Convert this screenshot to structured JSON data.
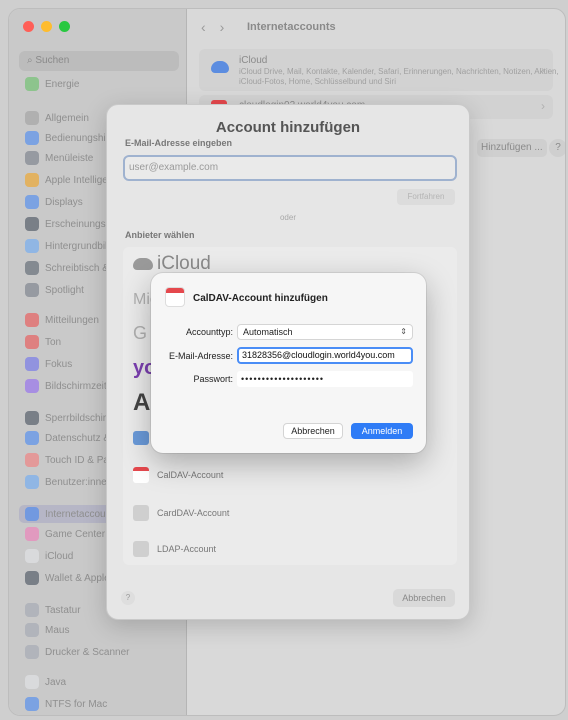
{
  "window": {
    "title": "Internetaccounts",
    "traffic": [
      "#ff5f57",
      "#febc2e",
      "#28c840"
    ]
  },
  "sidebar": {
    "search_placeholder": "Suchen",
    "items": [
      {
        "label": "Energie",
        "color": "#5bbf5b"
      },
      {
        "label": "Allgemein",
        "color": "#9a9a9a"
      },
      {
        "label": "Bedienungshilfen",
        "color": "#3b82f6"
      },
      {
        "label": "Menüleiste",
        "color": "#6b7280"
      },
      {
        "label": "Apple Intelligence",
        "color": "#f59e0b"
      },
      {
        "label": "Displays",
        "color": "#3b82f6"
      },
      {
        "label": "Erscheinungsbild",
        "color": "#374151"
      },
      {
        "label": "Hintergrundbild",
        "color": "#60a5fa"
      },
      {
        "label": "Schreibtisch & Dock",
        "color": "#4b5563"
      },
      {
        "label": "Spotlight",
        "color": "#6b7280"
      },
      {
        "label": "Mitteilungen",
        "color": "#ef4444"
      },
      {
        "label": "Ton",
        "color": "#ef4444"
      },
      {
        "label": "Fokus",
        "color": "#6366f1"
      },
      {
        "label": "Bildschirmzeit",
        "color": "#8b5cf6"
      },
      {
        "label": "Sperrbildschirm",
        "color": "#374151"
      },
      {
        "label": "Datenschutz & Sicherheit",
        "color": "#3b82f6"
      },
      {
        "label": "Touch ID & Passwort",
        "color": "#f87171"
      },
      {
        "label": "Benutzer:innen & Gruppen",
        "color": "#60a5fa"
      },
      {
        "label": "Internetaccounts",
        "color": "#3b82f6"
      },
      {
        "label": "Game Center",
        "color": "#f472b6"
      },
      {
        "label": "iCloud",
        "color": "#e5e7eb"
      },
      {
        "label": "Wallet & Apple Pay",
        "color": "#374151"
      },
      {
        "label": "Tastatur",
        "color": "#9ca3af"
      },
      {
        "label": "Maus",
        "color": "#9ca3af"
      },
      {
        "label": "Drucker & Scanner",
        "color": "#9ca3af"
      },
      {
        "label": "Java",
        "color": "#e5e7eb"
      },
      {
        "label": "NTFS for Mac",
        "color": "#3b82f6"
      }
    ]
  },
  "content": {
    "accounts": [
      {
        "name": "iCloud",
        "desc": "iCloud Drive, Mail, Kontakte, Kalender, Safari, Erinnerungen, Nachrichten, Notizen, Aktien, iCloud-Fotos, Home, Schlüsselbund und Siri"
      },
      {
        "name": "cloudlogin02.world4you.com",
        "desc": ""
      }
    ],
    "add_button": "Hinzufügen ...",
    "help_button": "?"
  },
  "sheet": {
    "title": "Account hinzufügen",
    "email_label": "E-Mail-Adresse eingeben",
    "email_placeholder": "user@example.com",
    "continue_button": "Fortfahren",
    "or_label": "oder",
    "provider_label": "Anbieter wählen",
    "providers": [
      {
        "name": "iCloud"
      },
      {
        "name": "Mic"
      },
      {
        "name": "G"
      },
      {
        "name": "yo"
      },
      {
        "name": "A"
      }
    ],
    "provider_rows": [
      {
        "name": "CalDAV-Account"
      },
      {
        "name": "CardDAV-Account"
      },
      {
        "name": "LDAP-Account"
      }
    ],
    "help_button": "?",
    "cancel_button": "Abbrechen"
  },
  "dialog": {
    "title": "CalDAV-Account hinzufügen",
    "account_type_label": "Accounttyp:",
    "account_type_value": "Automatisch",
    "email_label": "E-Mail-Adresse:",
    "email_value": "31828356@cloudlogin.world4you.com",
    "password_label": "Passwort:",
    "password_value": "••••••••••••••••••••",
    "cancel_button": "Abbrechen",
    "ok_button": "Anmelden"
  }
}
